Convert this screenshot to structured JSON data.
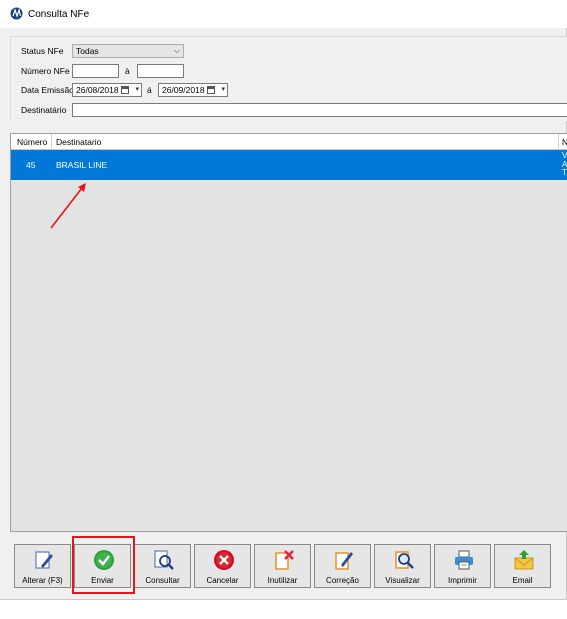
{
  "window": {
    "title": "Consulta NFe"
  },
  "filters": {
    "status_label": "Status NFe",
    "status_value": "Todas",
    "numero_label": "Número NFe",
    "numero_from": "",
    "numero_sep": "à",
    "numero_to": "",
    "data_label": "Data Emissão",
    "data_from": "26/08/2018",
    "data_sep": "á",
    "data_to": "26/09/2018",
    "destinatario_label": "Destinatário",
    "destinatario_value": ""
  },
  "grid": {
    "columns": [
      "Número",
      "Destinatario",
      "N"
    ],
    "rows": [
      {
        "numero": "45",
        "destinatario": "BRASIL LINE",
        "extra": [
          "V",
          "A",
          "T"
        ]
      }
    ]
  },
  "toolbar": {
    "buttons": [
      {
        "label": "Alterar (F3)",
        "icon": "edit-pencil-icon"
      },
      {
        "label": "Enviar",
        "icon": "check-circle-icon"
      },
      {
        "label": "Consultar",
        "icon": "document-search-icon"
      },
      {
        "label": "Cancelar",
        "icon": "cancel-x-icon"
      },
      {
        "label": "Inutilizar",
        "icon": "document-x-icon"
      },
      {
        "label": "Correção",
        "icon": "document-pencil-icon"
      },
      {
        "label": "Visualizar",
        "icon": "magnifier-icon"
      },
      {
        "label": "Imprimir",
        "icon": "printer-icon"
      },
      {
        "label": "Email",
        "icon": "envelope-upload-icon"
      }
    ]
  },
  "colors": {
    "selection": "#0078d7",
    "highlight": "#e8141a",
    "window_bg": "#f0f0f0"
  }
}
